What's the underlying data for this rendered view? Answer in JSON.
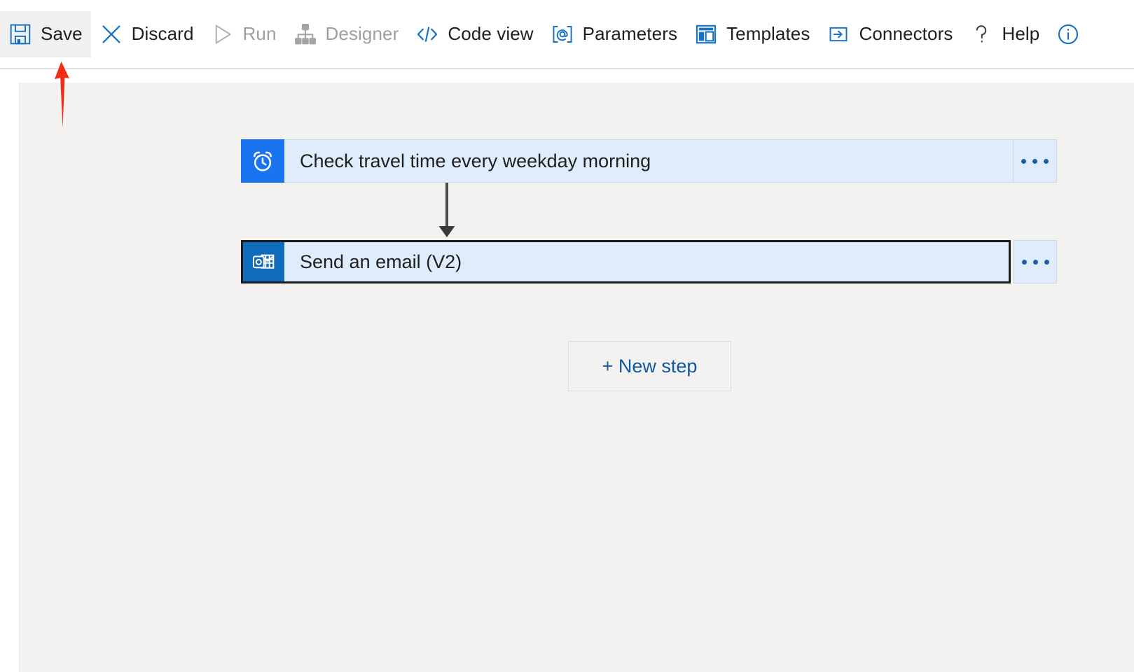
{
  "toolbar": {
    "items": [
      {
        "label": "Save",
        "icon": "save-icon",
        "state": "hover",
        "id": "save"
      },
      {
        "label": "Discard",
        "icon": "close-icon",
        "state": "enabled",
        "id": "discard"
      },
      {
        "label": "Run",
        "icon": "play-icon",
        "state": "disabled",
        "id": "run"
      },
      {
        "label": "Designer",
        "icon": "sitemap-icon",
        "state": "disabled",
        "id": "designer"
      },
      {
        "label": "Code view",
        "icon": "code-icon",
        "state": "enabled",
        "id": "code-view"
      },
      {
        "label": "Parameters",
        "icon": "at-bracket-icon",
        "state": "enabled",
        "id": "parameters"
      },
      {
        "label": "Templates",
        "icon": "templates-icon",
        "state": "enabled",
        "id": "templates"
      },
      {
        "label": "Connectors",
        "icon": "connectors-icon",
        "state": "enabled",
        "id": "connectors"
      },
      {
        "label": "Help",
        "icon": "question-icon",
        "state": "enabled",
        "id": "help"
      },
      {
        "label": "",
        "icon": "info-icon",
        "state": "enabled",
        "id": "info"
      }
    ]
  },
  "flow": {
    "trigger": {
      "title": "Check travel time every weekday morning",
      "icon": "alarm-clock-icon",
      "icon_color": "#1a73f0",
      "card_color": "#deecfb",
      "selected": false,
      "menu_label": "..."
    },
    "action": {
      "title": "Send an email (V2)",
      "icon": "outlook-mail-icon",
      "icon_color": "#0f6cbd",
      "card_color": "#deecfb",
      "selected": true,
      "menu_label": "..."
    },
    "connector": {
      "icon": "arrow-down-icon"
    },
    "new_step": {
      "label": "+ New step"
    }
  },
  "annotation": {
    "arrow": {
      "icon": "red-arrow-up-icon",
      "color": "#f12b14",
      "points_at": "Save"
    }
  },
  "colors": {
    "accent": "#0f6cbd",
    "canvas": "#f3f2f1",
    "card_fill": "#deecfb",
    "toolbar_bg": "#ffffff",
    "annotation_red": "#f12b14"
  }
}
